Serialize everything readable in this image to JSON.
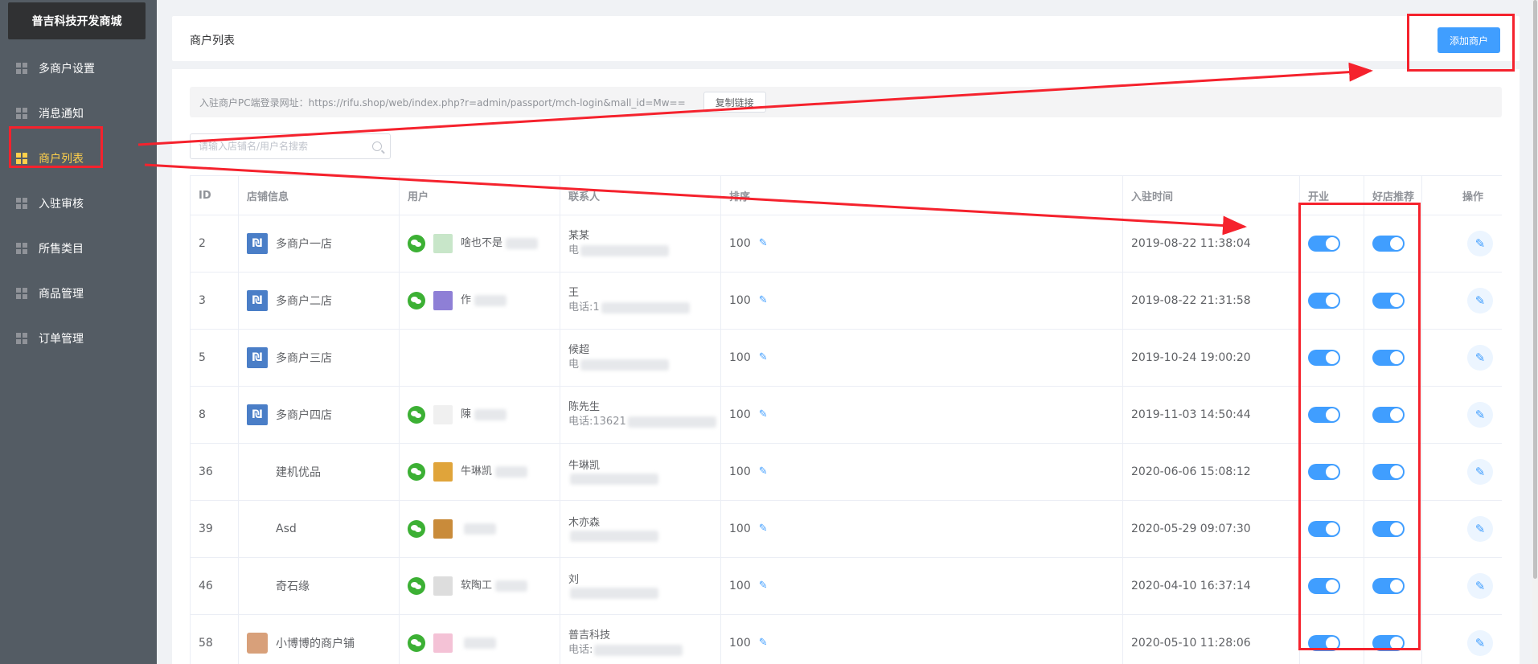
{
  "sidebar": {
    "brand": "普吉科技开发商城",
    "items": [
      {
        "label": "多商户设置",
        "active": false
      },
      {
        "label": "消息通知",
        "active": false
      },
      {
        "label": "商户列表",
        "active": true
      },
      {
        "label": "入驻审核",
        "active": false
      },
      {
        "label": "所售类目",
        "active": false
      },
      {
        "label": "商品管理",
        "active": false
      },
      {
        "label": "订单管理",
        "active": false
      }
    ]
  },
  "header": {
    "title": "商户列表",
    "add_label": "添加商户"
  },
  "url_bar": {
    "text": "入驻商户PC端登录网址：https://rifu.shop/web/index.php?r=admin/passport/mch-login&mall_id=Mw==",
    "copy_label": "复制链接"
  },
  "search": {
    "placeholder": "请输入店铺名/用户名搜索"
  },
  "table": {
    "headers": {
      "id": "ID",
      "shop": "店铺信息",
      "user": "用户",
      "contact": "联系人",
      "sort": "排序",
      "time": "入驻时间",
      "open": "开业",
      "rec": "好店推荐",
      "op": "操作"
    },
    "rows": [
      {
        "id": "2",
        "shop": "多商户一店",
        "logo": "logo",
        "user": "啥也不是",
        "contact": "某某",
        "phone": "电",
        "sort": "100",
        "time": "2019-08-22 11:38:04"
      },
      {
        "id": "3",
        "shop": "多商户二店",
        "logo": "logo",
        "user": "作",
        "contact": "王",
        "phone": "电话:1",
        "sort": "100",
        "time": "2019-08-22 21:31:58"
      },
      {
        "id": "5",
        "shop": "多商户三店",
        "logo": "logo",
        "user": "",
        "contact": "候超",
        "phone": "电",
        "sort": "100",
        "time": "2019-10-24 19:00:20"
      },
      {
        "id": "8",
        "shop": "多商户四店",
        "logo": "logo",
        "user": "陳",
        "contact": "陈先生",
        "phone": "电话:13621",
        "sort": "100",
        "time": "2019-11-03 14:50:44"
      },
      {
        "id": "36",
        "shop": "建机优品",
        "logo": "blank",
        "user": "牛琳凯",
        "contact": "牛琳凯",
        "phone": "",
        "sort": "100",
        "time": "2020-06-06 15:08:12"
      },
      {
        "id": "39",
        "shop": "Asd",
        "logo": "blank",
        "user": "",
        "contact": "木亦森",
        "phone": "",
        "sort": "100",
        "time": "2020-05-29 09:07:30"
      },
      {
        "id": "46",
        "shop": "奇石缘",
        "logo": "blank",
        "user": "软陶工",
        "contact": "刘",
        "phone": "",
        "sort": "100",
        "time": "2020-04-10 16:37:14"
      },
      {
        "id": "58",
        "shop": "小博博的商户铺",
        "logo": "photo",
        "user": "",
        "contact": "普吉科技",
        "phone": "电话:",
        "sort": "100",
        "time": "2020-05-10 11:28:06"
      }
    ]
  },
  "colors": {
    "sidebar_bg": "#545c64",
    "accent": "#409eff",
    "active_menu": "#ffd04b",
    "annotation": "#f5222d"
  }
}
